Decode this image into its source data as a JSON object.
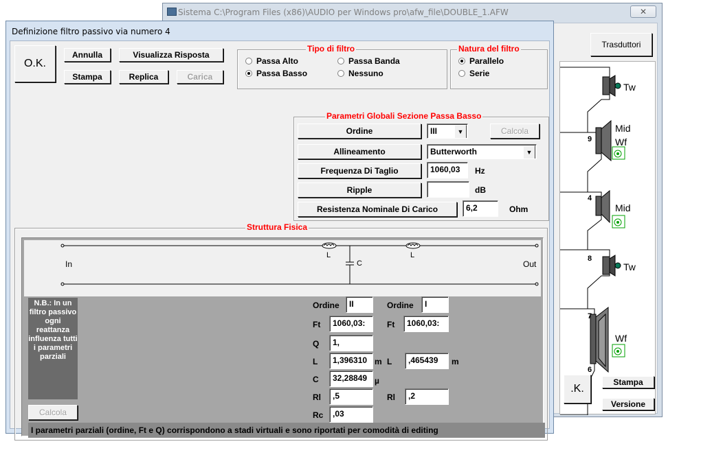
{
  "bg_window": {
    "title": "Sistema C:\\Program Files (x86)\\AUDIO per Windows pro\\afw_file\\DOUBLE_1.AFW",
    "close": "✕",
    "trasduttori_label": "Trasduttori",
    "ok_label": ".K.",
    "stampa_label": "Stampa",
    "versione_label": "Versione",
    "drivers": [
      {
        "name": "Tw",
        "number": "9"
      },
      {
        "name": "Mid Wf",
        "number": "4"
      },
      {
        "name": "Mid",
        "number": "8"
      },
      {
        "name": "Tw",
        "number": "7"
      },
      {
        "name": "Wf",
        "number": "6"
      }
    ]
  },
  "dialog": {
    "title": "Definizione filtro passivo via numero 4",
    "buttons": {
      "ok": "O.K.",
      "annulla": "Annulla",
      "visualizza": "Visualizza Risposta",
      "stampa": "Stampa",
      "replica": "Replica",
      "carica": "Carica"
    },
    "tipo_filtro": {
      "label": "Tipo di filtro",
      "options": [
        "Passa Alto",
        "Passa Banda",
        "Passa Basso",
        "Nessuno"
      ],
      "selected": "Passa Basso"
    },
    "natura_filtro": {
      "label": "Natura del filtro",
      "options": [
        "Parallelo",
        "Serie"
      ],
      "selected": "Parallelo"
    },
    "global_params": {
      "label": "Parametri Globali Sezione Passa Basso",
      "ordine_label": "Ordine",
      "ordine_value": "III",
      "calcola_label": "Calcola",
      "allineamento_label": "Allineamento",
      "allineamento_value": "Butterworth",
      "freq_label": "Frequenza Di Taglio",
      "freq_value": "1060,03",
      "freq_unit": "Hz",
      "ripple_label": "Ripple",
      "ripple_value": "",
      "ripple_unit": "dB",
      "res_label": "Resistenza Nominale Di Carico",
      "res_value": "6,2",
      "res_unit": "Ohm"
    },
    "struttura": {
      "label": "Struttura Fisica",
      "in_label": "In",
      "out_label": "Out",
      "l1": "L",
      "l2": "L",
      "c": "C",
      "note": "N.B.: In un filtro passivo ogni reattanza influenza tutti i parametri parziali",
      "calcola_label": "Calcola",
      "left": {
        "ordine_label": "Ordine",
        "ordine_value": "II",
        "ft_label": "Ft",
        "ft_value": "1060,03:",
        "q_label": "Q",
        "q_value": "1,",
        "l_label": "L",
        "l_value": "1,396310",
        "l_unit": "m",
        "c_label": "C",
        "c_value": "32,28849",
        "c_unit": "µ",
        "rl_label": "Rl",
        "rl_value": ",5",
        "rc_label": "Rc",
        "rc_value": ",03"
      },
      "right": {
        "ordine_label": "Ordine",
        "ordine_value": "I",
        "ft_label": "Ft",
        "ft_value": "1060,03:",
        "l_label": "L",
        "l_value": ",465439",
        "l_unit": "m",
        "rl_label": "Rl",
        "rl_value": ",2"
      },
      "footer": "I parametri parziali (ordine, Ft e Q) corrispondono a stadi virtuali e sono riportati per comodità di editing"
    }
  }
}
